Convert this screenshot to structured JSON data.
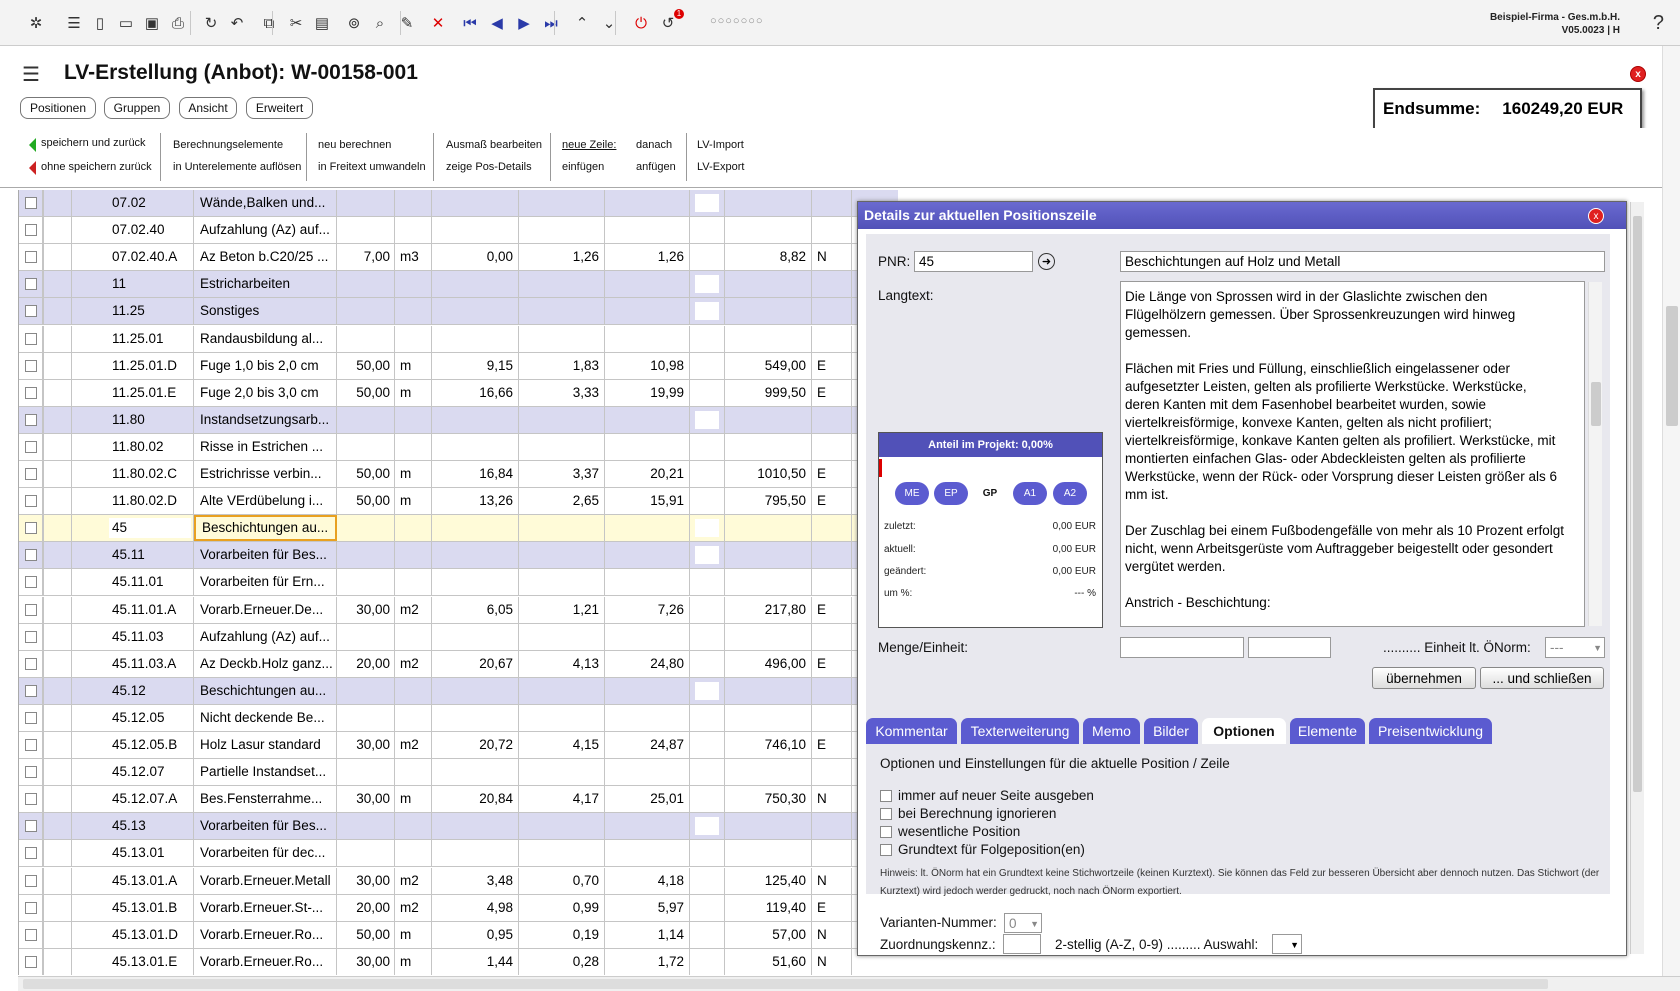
{
  "toolbar": {
    "icons": [
      "app-logo-icon",
      "menu-icon",
      "new-document-icon",
      "open-folder-icon",
      "save-icon",
      "pdf-print-icon",
      "refresh-icon",
      "undo-icon",
      "copy-icon",
      "cut-icon",
      "paste-icon",
      "binoculars-icon",
      "search-icon",
      "edit-icon",
      "delete-icon",
      "first-icon",
      "prev-icon",
      "next-icon",
      "last-icon",
      "collapse-icon",
      "expand-icon",
      "power-icon",
      "notification-icon"
    ],
    "notification_badge": "1",
    "dots": "○○○○○○○",
    "company": "Beispiel-Firma - Ges.m.b.H.",
    "version": "V05.0023 | H",
    "help": "?"
  },
  "page": {
    "title": "LV-Erstellung (Anbot): W-00158-001",
    "close": "x"
  },
  "tabs": [
    "Positionen",
    "Gruppen",
    "Ansicht",
    "Erweitert"
  ],
  "endsumme": {
    "label": "Endsumme:",
    "value": "160249,20 EUR"
  },
  "actions": {
    "save_back": "speichern und zurück",
    "nosave_back": "ohne speichern zurück",
    "calc1": "Berechnungselemente",
    "calc2": "in Unterelemente auflösen",
    "recalc1": "neu berechnen",
    "recalc2": "in Freitext umwandeln",
    "aus1": "Ausmaß bearbeiten",
    "aus2": "zeige Pos-Details",
    "newrow": "neue Zeile:",
    "insert": "einfügen",
    "after": "danach",
    "append": "anfügen",
    "imp": "LV-Import",
    "exp": "LV-Export"
  },
  "rows": [
    {
      "nr": "07.02",
      "txt": "Wände,Balken und...",
      "h": true
    },
    {
      "nr": "07.02.40",
      "txt": "Aufzahlung (Az) auf..."
    },
    {
      "nr": "07.02.40.A",
      "txt": "Az Beton b.C20/25 ...",
      "qty": "7,00",
      "unit": "m3",
      "v1": "0,00",
      "v2": "1,26",
      "v3": "1,26",
      "tot": "8,82",
      "fl": "N"
    },
    {
      "nr": "11",
      "txt": "Estricharbeiten",
      "h": true
    },
    {
      "nr": "11.25",
      "txt": "Sonstiges",
      "h": true
    },
    {
      "nr": "11.25.01",
      "txt": "Randausbildung al..."
    },
    {
      "nr": "11.25.01.D",
      "txt": "Fuge 1,0 bis 2,0 cm",
      "qty": "50,00",
      "unit": "m",
      "v1": "9,15",
      "v2": "1,83",
      "v3": "10,98",
      "tot": "549,00",
      "fl": "E"
    },
    {
      "nr": "11.25.01.E",
      "txt": "Fuge 2,0 bis 3,0 cm",
      "qty": "50,00",
      "unit": "m",
      "v1": "16,66",
      "v2": "3,33",
      "v3": "19,99",
      "tot": "999,50",
      "fl": "E"
    },
    {
      "nr": "11.80",
      "txt": "Instandsetzungsarb...",
      "h": true
    },
    {
      "nr": "11.80.02",
      "txt": "Risse in Estrichen ..."
    },
    {
      "nr": "11.80.02.C",
      "txt": "Estrichrisse verbin...",
      "qty": "50,00",
      "unit": "m",
      "v1": "16,84",
      "v2": "3,37",
      "v3": "20,21",
      "tot": "1010,50",
      "fl": "E"
    },
    {
      "nr": "11.80.02.D",
      "txt": "Alte VErdübelung i...",
      "qty": "50,00",
      "unit": "m",
      "v1": "13,26",
      "v2": "2,65",
      "v3": "15,91",
      "tot": "795,50",
      "fl": "E"
    },
    {
      "nr": "45",
      "txt": "Beschichtungen au...",
      "sel": true
    },
    {
      "nr": "45.11",
      "txt": "Vorarbeiten für Bes...",
      "h": true
    },
    {
      "nr": "45.11.01",
      "txt": "Vorarbeiten für Ern..."
    },
    {
      "nr": "45.11.01.A",
      "txt": "Vorarb.Erneuer.De...",
      "qty": "30,00",
      "unit": "m2",
      "v1": "6,05",
      "v2": "1,21",
      "v3": "7,26",
      "tot": "217,80",
      "fl": "E"
    },
    {
      "nr": "45.11.03",
      "txt": "Aufzahlung (Az) auf..."
    },
    {
      "nr": "45.11.03.A",
      "txt": "Az Deckb.Holz ganz...",
      "qty": "20,00",
      "unit": "m2",
      "v1": "20,67",
      "v2": "4,13",
      "v3": "24,80",
      "tot": "496,00",
      "fl": "E"
    },
    {
      "nr": "45.12",
      "txt": "Beschichtungen au...",
      "h": true
    },
    {
      "nr": "45.12.05",
      "txt": "Nicht deckende Be..."
    },
    {
      "nr": "45.12.05.B",
      "txt": "Holz Lasur standard",
      "qty": "30,00",
      "unit": "m2",
      "v1": "20,72",
      "v2": "4,15",
      "v3": "24,87",
      "tot": "746,10",
      "fl": "E"
    },
    {
      "nr": "45.12.07",
      "txt": "Partielle Instandset..."
    },
    {
      "nr": "45.12.07.A",
      "txt": "Bes.Fensterrahme...",
      "qty": "30,00",
      "unit": "m",
      "v1": "20,84",
      "v2": "4,17",
      "v3": "25,01",
      "tot": "750,30",
      "fl": "N"
    },
    {
      "nr": "45.13",
      "txt": "Vorarbeiten für Bes...",
      "h": true
    },
    {
      "nr": "45.13.01",
      "txt": "Vorarbeiten für dec..."
    },
    {
      "nr": "45.13.01.A",
      "txt": "Vorarb.Erneuer.Metall",
      "qty": "30,00",
      "unit": "m2",
      "v1": "3,48",
      "v2": "0,70",
      "v3": "4,18",
      "tot": "125,40",
      "fl": "N"
    },
    {
      "nr": "45.13.01.B",
      "txt": "Vorarb.Erneuer.St-...",
      "qty": "20,00",
      "unit": "m2",
      "v1": "4,98",
      "v2": "0,99",
      "v3": "5,97",
      "tot": "119,40",
      "fl": "E"
    },
    {
      "nr": "45.13.01.D",
      "txt": "Vorarb.Erneuer.Ro...",
      "qty": "50,00",
      "unit": "m",
      "v1": "0,95",
      "v2": "0,19",
      "v3": "1,14",
      "tot": "57,00",
      "fl": "N"
    },
    {
      "nr": "45.13.01.E",
      "txt": "Vorarb.Erneuer.Ro...",
      "qty": "30,00",
      "unit": "m",
      "v1": "1,44",
      "v2": "0,28",
      "v3": "1,72",
      "tot": "51,60",
      "fl": "N"
    }
  ],
  "panel": {
    "title": "Details zur aktuellen Positionszeile",
    "close": "x",
    "pnr_label": "PNR:",
    "pnr_value": "45",
    "kurztext": "Beschichtungen auf Holz und Metall",
    "langtext_label": "Langtext:",
    "langtext": [
      "Die Länge von Sprossen wird in der Glaslichte zwischen den Flügelhölzern gemessen. Über Sprossenkreuzungen wird hinweg gemessen.",
      "Flächen mit Fries und Füllung, einschließlich eingelassener oder aufgesetzter Leisten, gelten als profilierte Werkstücke. Werkstücke, deren Kanten mit dem Fasenhobel bearbeitet wurden, sowie viertelkreisförmige, konvexe Kanten, gelten als nicht profiliert; viertelkreisförmige, konkave Kanten gelten als profiliert. Werkstücke, mit montierten einfachen Glas- oder Abdeckleisten gelten als profilierte Werkstücke, wenn der Rück- oder Vorsprung dieser Leisten größer als 6 mm ist.",
      "Der Zuschlag bei einem Fußbodengefälle von mehr als 10 Prozent erfolgt nicht, wenn Arbeitsgerüste vom Auftraggeber beigestellt oder gesondert vergütet werden.",
      "Anstrich - Beschichtung:"
    ],
    "anteil": "Anteil im Projekt: 0,00%",
    "pills": [
      "ME",
      "EP",
      "GP",
      "A1",
      "A2"
    ],
    "zuletzt_l": "zuletzt:",
    "zuletzt_v": "0,00 EUR",
    "aktuell_l": "aktuell:",
    "aktuell_v": "0,00 EUR",
    "geaendert_l": "geändert:",
    "geaendert_v": "0,00 EUR",
    "umpct_l": "um %:",
    "umpct_v": "--- %",
    "menge_label": "Menge/Einheit:",
    "einheit_label": ".......... Einheit lt. ÖNorm:",
    "einheit_value": "---",
    "btn_take": "übernehmen",
    "btn_close": "... und schließen",
    "tabs": [
      "Kommentar",
      "Texterweiterung",
      "Memo",
      "Bilder",
      "Optionen",
      "Elemente",
      "Preisentwicklung"
    ],
    "opt_title": "Optionen und Einstellungen für die aktuelle Position / Zeile",
    "opts": [
      "immer auf neuer Seite ausgeben",
      "bei Berechnung ignorieren",
      "wesentliche Position",
      "Grundtext für Folgeposition(en)"
    ],
    "hinweis": "Hinweis: lt. ÖNorm hat ein Grundtext keine Stichwortzeile (keinen Kurztext). Sie können das Feld zur besseren Übersicht aber dennoch nutzen. Das Stichwort (der Kurztext) wird jedoch werder gedruckt, noch nach ÖNorm exportiert.",
    "varianten_label": "Varianten-Nummer:",
    "varianten_value": "0",
    "zuord_label": "Zuordnungskennz.:",
    "zuord_hint": "2-stellig (A-Z, 0-9) ......... Auswahl:"
  }
}
